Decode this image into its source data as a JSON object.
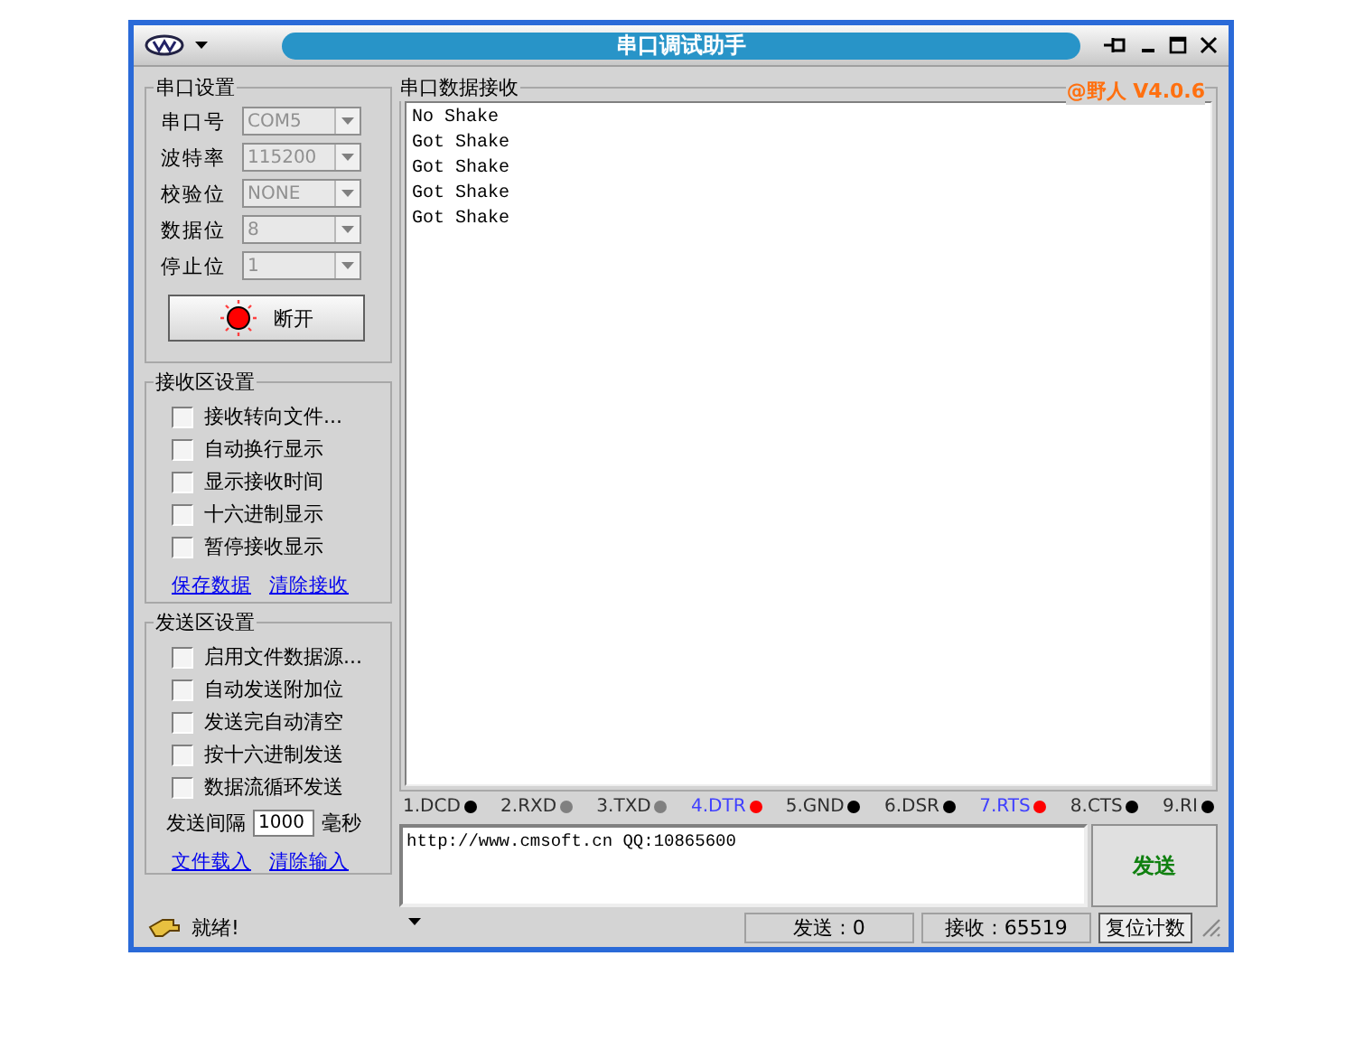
{
  "window": {
    "title": "串口调试助手"
  },
  "serial_settings": {
    "title": "串口设置",
    "fields": [
      {
        "label": "串口号",
        "value": "COM5"
      },
      {
        "label": "波特率",
        "value": "115200"
      },
      {
        "label": "校验位",
        "value": "NONE"
      },
      {
        "label": "数据位",
        "value": "8"
      },
      {
        "label": "停止位",
        "value": "1"
      }
    ],
    "connect_button": {
      "label": "断开",
      "on": true
    }
  },
  "receive_settings": {
    "title": "接收区设置",
    "options": [
      {
        "label": "接收转向文件...",
        "checked": false
      },
      {
        "label": "自动换行显示",
        "checked": false
      },
      {
        "label": "显示接收时间",
        "checked": false
      },
      {
        "label": "十六进制显示",
        "checked": false
      },
      {
        "label": "暂停接收显示",
        "checked": false
      }
    ],
    "links": [
      "保存数据",
      "清除接收"
    ]
  },
  "send_settings": {
    "title": "发送区设置",
    "options": [
      {
        "label": "启用文件数据源...",
        "checked": false
      },
      {
        "label": "自动发送附加位",
        "checked": false
      },
      {
        "label": "发送完自动清空",
        "checked": false
      },
      {
        "label": "按十六进制发送",
        "checked": false
      },
      {
        "label": "数据流循环发送",
        "checked": false
      }
    ],
    "interval_label": "发送间隔",
    "interval_value": "1000",
    "interval_unit": "毫秒",
    "links": [
      "文件载入",
      "清除输入"
    ]
  },
  "receive_panel": {
    "title": "串口数据接收",
    "version": "@野人 V4.0.6",
    "lines": [
      "No Shake",
      "Got Shake",
      "Got Shake",
      "Got Shake",
      "Got Shake"
    ]
  },
  "signals": [
    {
      "label": "1.DCD",
      "active": false,
      "color": "#000000"
    },
    {
      "label": "2.RXD",
      "active": false,
      "color": "#808080"
    },
    {
      "label": "3.TXD",
      "active": false,
      "color": "#808080"
    },
    {
      "label": "4.DTR",
      "active": true,
      "color": "#ff0000"
    },
    {
      "label": "5.GND",
      "active": false,
      "color": "#000000"
    },
    {
      "label": "6.DSR",
      "active": false,
      "color": "#000000"
    },
    {
      "label": "7.RTS",
      "active": true,
      "color": "#ff0000"
    },
    {
      "label": "8.CTS",
      "active": false,
      "color": "#000000"
    },
    {
      "label": "9.RI",
      "active": false,
      "color": "#000000"
    }
  ],
  "send_input": {
    "value": "http://www.cmsoft.cn QQ:10865600"
  },
  "send_button": "发送",
  "status_bar": {
    "message": "就绪!",
    "sent": "发送 : 0",
    "received": "接收 : 65519",
    "reset_button": "复位计数"
  }
}
